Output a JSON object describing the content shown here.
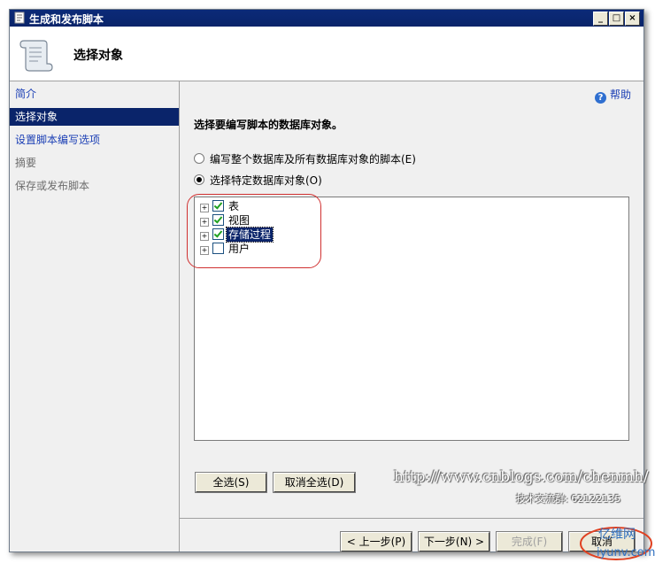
{
  "window": {
    "title": "生成和发布脚本",
    "min": "_",
    "max": "□",
    "close": "×"
  },
  "header": {
    "title": "选择对象"
  },
  "nav": {
    "items": [
      {
        "label": "简介",
        "state": "link"
      },
      {
        "label": "选择对象",
        "state": "selected"
      },
      {
        "label": "设置脚本编写选项",
        "state": "link"
      },
      {
        "label": "摘要",
        "state": "disabled"
      },
      {
        "label": "保存或发布脚本",
        "state": "disabled"
      }
    ]
  },
  "main": {
    "help": "帮助",
    "section_title": "选择要编写脚本的数据库对象。",
    "radio_all": "编写整个数据库及所有数据库对象的脚本(E)",
    "radio_specific": "选择特定数据库对象(O)",
    "tree": [
      {
        "label": "表",
        "checked": true
      },
      {
        "label": "视图",
        "checked": true
      },
      {
        "label": "存储过程",
        "checked": true,
        "selected": true
      },
      {
        "label": "用户",
        "checked": false
      }
    ],
    "select_all": "全选(S)",
    "deselect_all": "取消全选(D)"
  },
  "watermark": {
    "url": "http://www.cnblogs.com/chenmh/",
    "qq": "技术交流群: 62122135",
    "site_top": "亿维网",
    "site_bottom": "iyunv.com"
  },
  "footer": {
    "prev": "< 上一步(P)",
    "next": "下一步(N) >",
    "finish": "完成(F)",
    "cancel": "取消"
  },
  "colors": {
    "selection": "#0a246a",
    "link": "#1b3fb5",
    "annotation": "#d03030"
  }
}
